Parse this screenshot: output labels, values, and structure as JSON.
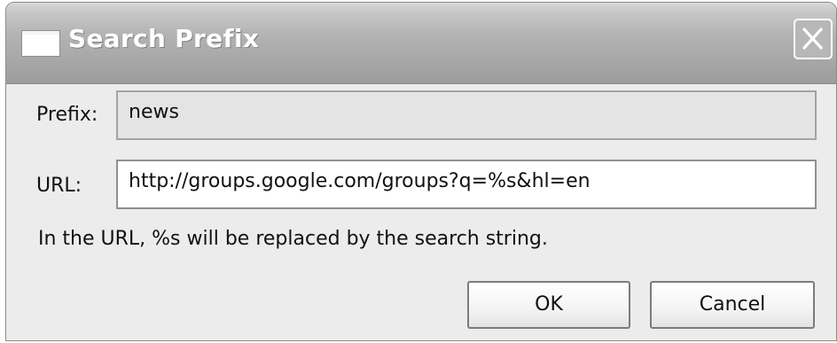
{
  "dialog": {
    "title": "Search Prefix",
    "close_icon": "close-icon",
    "window_icon": "window-icon"
  },
  "form": {
    "prefix_label": "Prefix:",
    "prefix_value": "news",
    "url_label": "URL:",
    "url_value": "http://groups.google.com/groups?q=%s&hl=en",
    "hint": "In the URL, %s will be replaced by the search string."
  },
  "buttons": {
    "ok_label": "OK",
    "cancel_label": "Cancel"
  }
}
